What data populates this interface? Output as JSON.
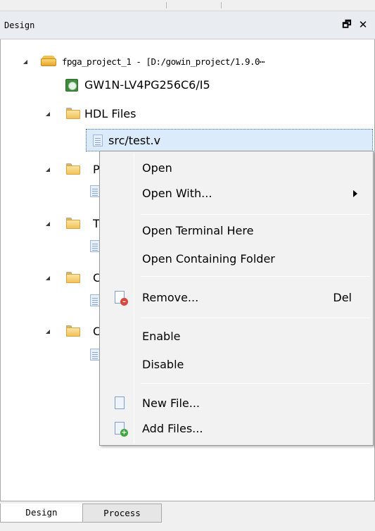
{
  "panel": {
    "title": "Design",
    "float_glyph": "🗗",
    "close_glyph": "✕"
  },
  "tree": {
    "project": {
      "label": "fpga_project_1 - [D:/gowin_project/1.9.0⋯",
      "icon": "project-icon"
    },
    "device": {
      "label": "GW1N-LV4PG256C6/I5",
      "icon": "device-chip-icon"
    },
    "folders": [
      {
        "label": "HDL Files",
        "children": [
          "src/test.v"
        ]
      },
      {
        "label": "P",
        "children": [
          ""
        ]
      },
      {
        "label": "T",
        "children": [
          ""
        ]
      },
      {
        "label": "C",
        "children": [
          ""
        ]
      },
      {
        "label": "C",
        "children": [
          ""
        ]
      }
    ],
    "selected_file": "src/test.v"
  },
  "context_menu": {
    "items": [
      {
        "label": "Open"
      },
      {
        "label": "Open With...",
        "submenu": true
      },
      {
        "label": "Open Terminal Here"
      },
      {
        "label": "Open Containing Folder"
      },
      {
        "label": "Remove...",
        "shortcut": "Del",
        "icon": "remove-file-icon"
      },
      {
        "label": "Enable"
      },
      {
        "label": "Disable"
      },
      {
        "label": "New File...",
        "icon": "new-file-icon"
      },
      {
        "label": "Add Files...",
        "icon": "add-files-icon"
      }
    ]
  },
  "bottom_tabs": [
    {
      "label": "Design",
      "active": true
    },
    {
      "label": "Process",
      "active": false
    }
  ],
  "colors": {
    "selection": "#dcebfc",
    "menu_bg": "#f2f2f2",
    "titlebar_bg": "#e9edf1"
  }
}
